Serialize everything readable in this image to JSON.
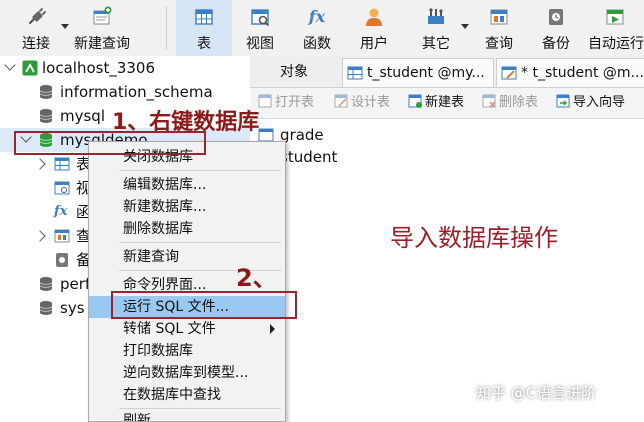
{
  "toolbar": {
    "buttons": [
      {
        "label": "连接",
        "icon": "plug-icon"
      },
      {
        "label": "新建查询",
        "icon": "new-query-icon"
      },
      {
        "label": "表",
        "icon": "table-icon"
      },
      {
        "label": "视图",
        "icon": "view-icon"
      },
      {
        "label": "函数",
        "icon": "fx-icon"
      },
      {
        "label": "用户",
        "icon": "user-icon"
      },
      {
        "label": "其它",
        "icon": "tools-icon"
      },
      {
        "label": "查询",
        "icon": "query-icon"
      },
      {
        "label": "备份",
        "icon": "backup-icon"
      },
      {
        "label": "自动运行",
        "icon": "auto-run-icon"
      }
    ],
    "fx_glyph": "fx",
    "active": "表"
  },
  "tree": {
    "connection": "localhost_3306",
    "databases": [
      "information_schema",
      "mysql",
      "mysqldemo",
      "performance_schema",
      "sys"
    ],
    "children_partial": [
      "表",
      "视",
      "函",
      "查",
      "备"
    ],
    "child_icons": [
      "table-icon",
      "view-icon",
      "fx-icon",
      "query-icon",
      "backup-icon"
    ],
    "fx_glyph": "fx"
  },
  "tabs": {
    "objects": "对象",
    "tab1": "t_student @my...",
    "tab2": "* t_student @m..."
  },
  "subtoolbar": {
    "open": "打开表",
    "design": "设计表",
    "new": "新建表",
    "delete": "删除表",
    "import": "导入向导"
  },
  "objects": [
    "grade",
    "student"
  ],
  "context_menu": {
    "items": [
      {
        "label": "关闭数据库"
      },
      {
        "label": "编辑数据库..."
      },
      {
        "label": "新建数据库..."
      },
      {
        "label": "删除数据库"
      },
      {
        "label": "新建查询"
      },
      {
        "label": "命令列界面..."
      },
      {
        "label": "运行 SQL 文件...",
        "highlighted": true
      },
      {
        "label": "转储 SQL 文件",
        "has_submenu": true
      },
      {
        "label": "打印数据库"
      },
      {
        "label": "逆向数据库到模型..."
      },
      {
        "label": "在数据库中查找"
      },
      {
        "label": "刷新"
      }
    ]
  },
  "annotations": {
    "step1": "1、右键数据库",
    "step2": "2、",
    "title": "导入数据库操作"
  },
  "watermark": "知乎 @C语言进阶",
  "colors": {
    "annotation": "#8c1a1a",
    "highlight": "#99c9f0",
    "db_green": "#2e9a3a"
  }
}
